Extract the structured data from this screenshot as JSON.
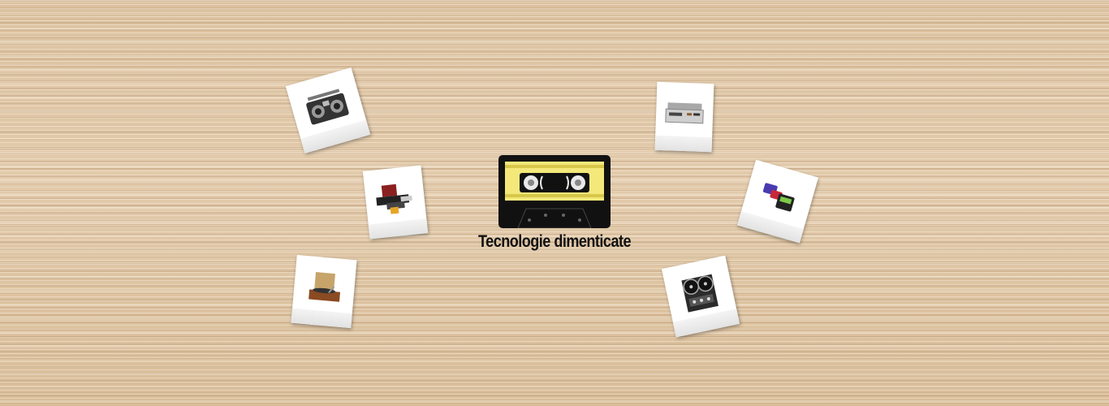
{
  "title": "Tecnologie dimenticate",
  "colors": {
    "cassette_body": "#111111",
    "cassette_label": "#f4e87a",
    "wood": "#ddc3a2"
  },
  "logo": {
    "icon": "cassette-tape-icon"
  },
  "photos": [
    {
      "icon": "boombox-icon"
    },
    {
      "icon": "typewriter-icon"
    },
    {
      "icon": "record-player-icon"
    },
    {
      "icon": "vcr-player-icon"
    },
    {
      "icon": "pager-icon"
    },
    {
      "icon": "reel-to-reel-tape-recorder-icon"
    }
  ]
}
